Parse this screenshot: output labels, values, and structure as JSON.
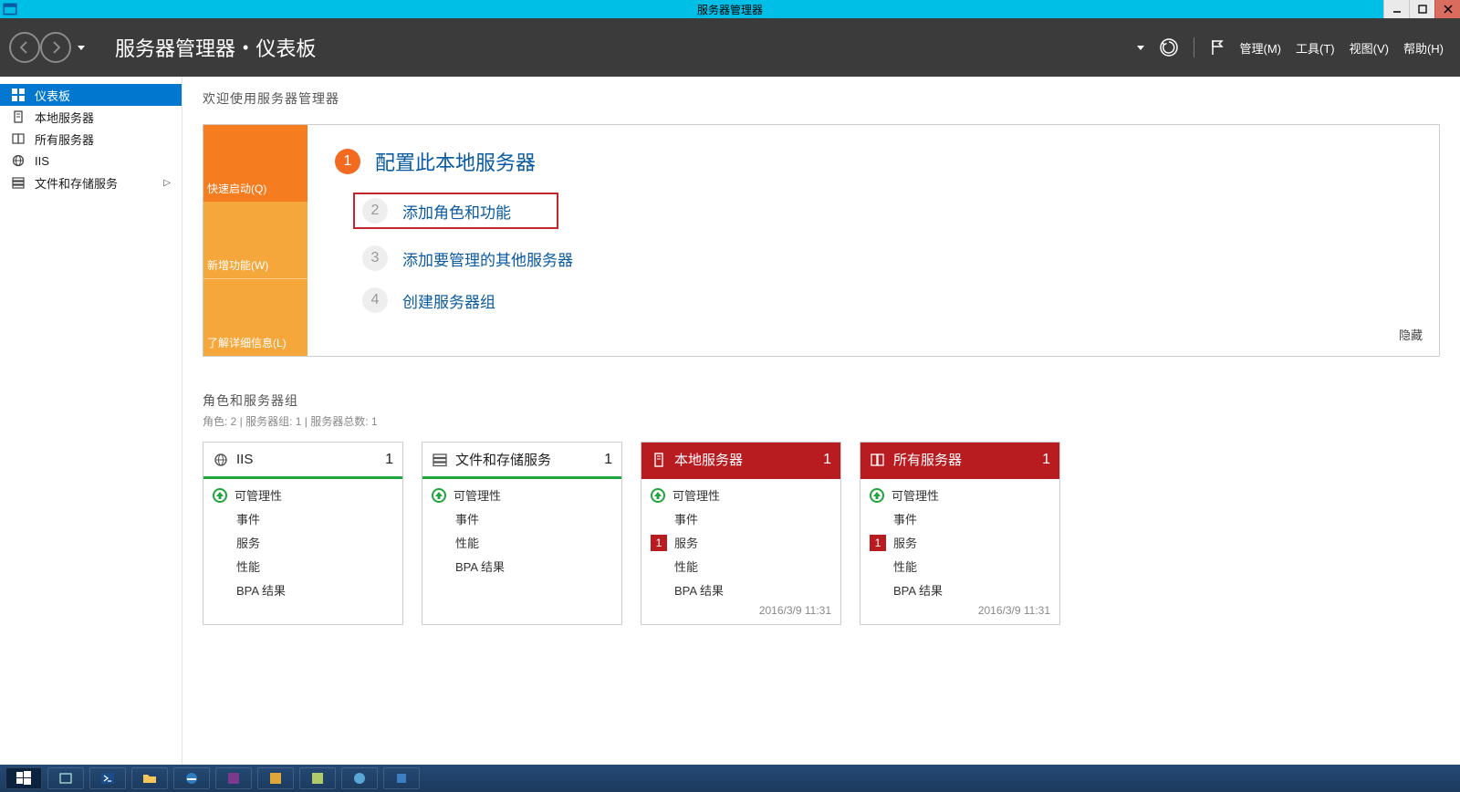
{
  "window": {
    "title": "服务器管理器"
  },
  "header": {
    "breadcrumb_app": "服务器管理器",
    "breadcrumb_page": "仪表板",
    "menu_manage": "管理(M)",
    "menu_tools": "工具(T)",
    "menu_view": "视图(V)",
    "menu_help": "帮助(H)"
  },
  "sidebar": {
    "items": [
      {
        "label": "仪表板",
        "icon": "dashboard-icon"
      },
      {
        "label": "本地服务器",
        "icon": "server-icon"
      },
      {
        "label": "所有服务器",
        "icon": "servers-icon"
      },
      {
        "label": "IIS",
        "icon": "iis-icon"
      },
      {
        "label": "文件和存储服务",
        "icon": "storage-icon",
        "expandable": true
      }
    ]
  },
  "welcome": {
    "title": "欢迎使用服务器管理器",
    "tabs": {
      "quickstart": "快速启动(Q)",
      "whatsnew": "新增功能(W)",
      "learnmore": "了解详细信息(L)"
    },
    "step1": "配置此本地服务器",
    "step2": "添加角色和功能",
    "step3": "添加要管理的其他服务器",
    "step4": "创建服务器组",
    "hide": "隐藏"
  },
  "roles": {
    "title": "角色和服务器组",
    "subtitle": "角色: 2 | 服务器组: 1 | 服务器总数: 1",
    "labels": {
      "manageability": "可管理性",
      "events": "事件",
      "services": "服务",
      "performance": "性能",
      "bpa": "BPA 结果"
    },
    "tiles": [
      {
        "name": "IIS",
        "count": "1",
        "style": "green",
        "rows": [
          "manageability",
          "events",
          "services",
          "performance",
          "bpa"
        ],
        "timestamp": ""
      },
      {
        "name": "文件和存储服务",
        "count": "1",
        "style": "green",
        "rows": [
          "manageability",
          "events",
          "performance",
          "bpa"
        ],
        "timestamp": ""
      },
      {
        "name": "本地服务器",
        "count": "1",
        "style": "red",
        "alert_on": "services",
        "alert_count": "1",
        "rows": [
          "manageability",
          "events",
          "services",
          "performance",
          "bpa"
        ],
        "timestamp": "2016/3/9 11:31"
      },
      {
        "name": "所有服务器",
        "count": "1",
        "style": "red",
        "alert_on": "services",
        "alert_count": "1",
        "rows": [
          "manageability",
          "events",
          "services",
          "performance",
          "bpa"
        ],
        "timestamp": "2016/3/9 11:31"
      }
    ]
  }
}
